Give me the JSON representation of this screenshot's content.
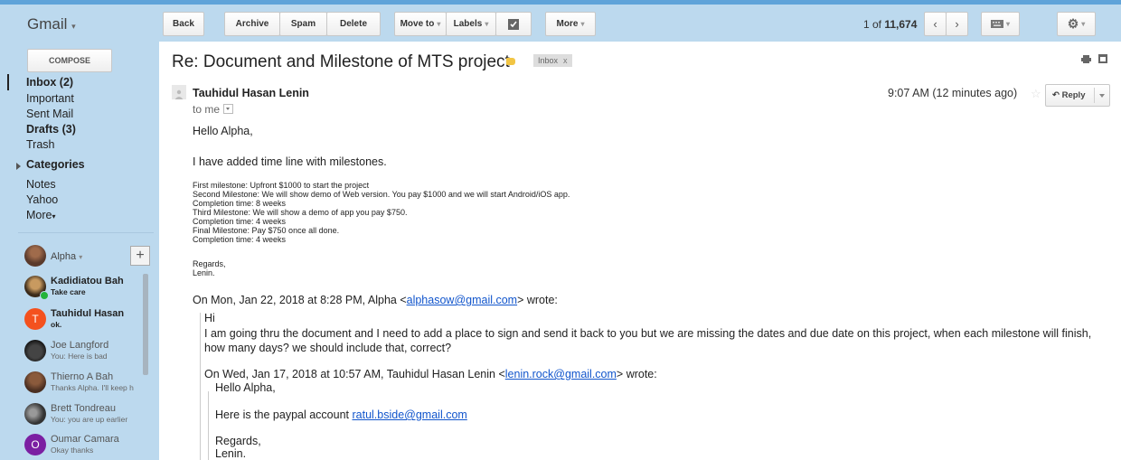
{
  "app": {
    "logo": "Gmail"
  },
  "toolbar": {
    "back": "Back",
    "archive": "Archive",
    "spam": "Spam",
    "delete": "Delete",
    "move_to": "Move to",
    "labels": "Labels",
    "more": "More",
    "pager_prefix": "1 of ",
    "pager_total": "11,674"
  },
  "sidebar": {
    "compose": "COMPOSE",
    "nav": [
      {
        "label": "Inbox (2)",
        "bold": true
      },
      {
        "label": "Important",
        "bold": false
      },
      {
        "label": "Sent Mail",
        "bold": false
      },
      {
        "label": "Drafts (3)",
        "bold": true
      },
      {
        "label": "Trash",
        "bold": false
      },
      {
        "label": "Categories",
        "bold": true
      },
      {
        "label": "Notes",
        "bold": false
      },
      {
        "label": "Yahoo",
        "bold": false
      },
      {
        "label": "More",
        "bold": false
      }
    ],
    "me": "Alpha",
    "contacts": [
      {
        "name": "Kadidiatou Bah",
        "status": "Take care"
      },
      {
        "name": "Tauhidul Hasan",
        "status": "ok.",
        "initial": "T"
      },
      {
        "name": "Joe Langford",
        "status": "You: Here is bad"
      },
      {
        "name": "Thierno A Bah",
        "status": "Thanks Alpha. I'll keep h"
      },
      {
        "name": "Brett Tondreau",
        "status": "You: you are up earlier"
      },
      {
        "name": "Oumar Camara",
        "status": "Okay thanks",
        "initial": "O"
      }
    ]
  },
  "colors": {
    "sidebar_bg": "#bcd9ee",
    "topbar_accent": "#5fa3d9",
    "link": "#1155cc",
    "label_tag": "#f2c544"
  },
  "message": {
    "subject": "Re: Document and Milestone of MTS project",
    "inbox_chip": "Inbox",
    "chip_close": "x",
    "sender": "Tauhidul Hasan Lenin",
    "to": "to me",
    "time": "9:07 AM (12 minutes ago)",
    "reply": "Reply",
    "greeting": "Hello Alpha,",
    "intro": "I have added time line with milestones.",
    "milestones": [
      "First milestone: Upfront $1000 to start the project",
      "Second Milestone: We will show demo of Web version. You pay $1000 and we will start Android/iOS app.",
      "Completion time: 8 weeks",
      "Third Milestone: We will show a demo of app you pay $750.",
      "Completion time: 4 weeks",
      "Final Milestone: Pay $750 once all done.",
      "Completion time: 4 weeks"
    ],
    "sign1": "Regards,",
    "sign2": "Lenin.",
    "quote1_header_pre": "On Mon, Jan 22, 2018 at 8:28 PM, Alpha <",
    "quote1_email": "alphasow@gmail.com",
    "quote1_header_post": "> wrote:",
    "quote1_hi": "Hi",
    "quote1_body": "I am going thru the document and I need to add a place to sign and send it back to you but we are missing the dates and due date on this project, when each milestone will finish, how many days? we should include that, correct?",
    "quote2_header_pre": "On Wed, Jan 17, 2018 at 10:57 AM, Tauhidul Hasan Lenin <",
    "quote2_email": "lenin.rock@gmail.com",
    "quote2_header_post": "> wrote:",
    "quote2_greeting": "Hello Alpha,",
    "quote2_paypal_pre": "Here is the paypal account ",
    "quote2_paypal_email": "ratul.bside@gmail.com",
    "quote2_sign1": "Regards,",
    "quote2_sign2": "Lenin."
  }
}
